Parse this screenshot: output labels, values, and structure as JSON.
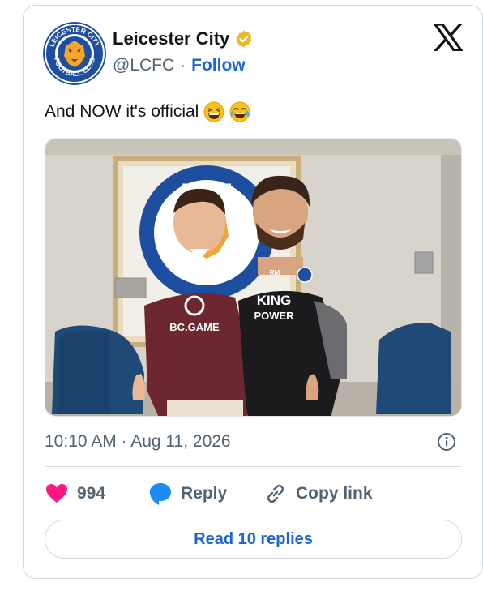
{
  "account": {
    "display_name": "Leicester City",
    "handle": "@LCFC",
    "separator": "·",
    "follow_label": "Follow",
    "avatar_text_top": "LEICESTER CITY",
    "avatar_text_bottom": "FOOTBALL CLUB",
    "verified_color": "#e8b829"
  },
  "tweet": {
    "text": "And NOW it's official",
    "emojis": [
      "grinning-squinting-face",
      "face-with-tears-of-joy"
    ],
    "photo": {
      "crest_text": "ESTE",
      "shirt_left_text": "BC.GAME",
      "shirt_right_text_1": "KING",
      "shirt_right_text_2": "POWER",
      "shirt_right_initials": "RM"
    },
    "timestamp": "10:10 AM · Aug 11, 2026"
  },
  "actions": {
    "like_count": "994",
    "reply_label": "Reply",
    "copy_label": "Copy link",
    "read_replies_label": "Read 10 replies"
  },
  "colors": {
    "accent": "#1d64d4",
    "like": "#f91880",
    "reply_icon": "#1d8cf0",
    "muted": "#536471"
  },
  "icons": {
    "brand": "x-logo-icon",
    "info": "info-icon",
    "like": "heart-icon",
    "reply": "speech-bubble-icon",
    "copy": "link-icon"
  }
}
